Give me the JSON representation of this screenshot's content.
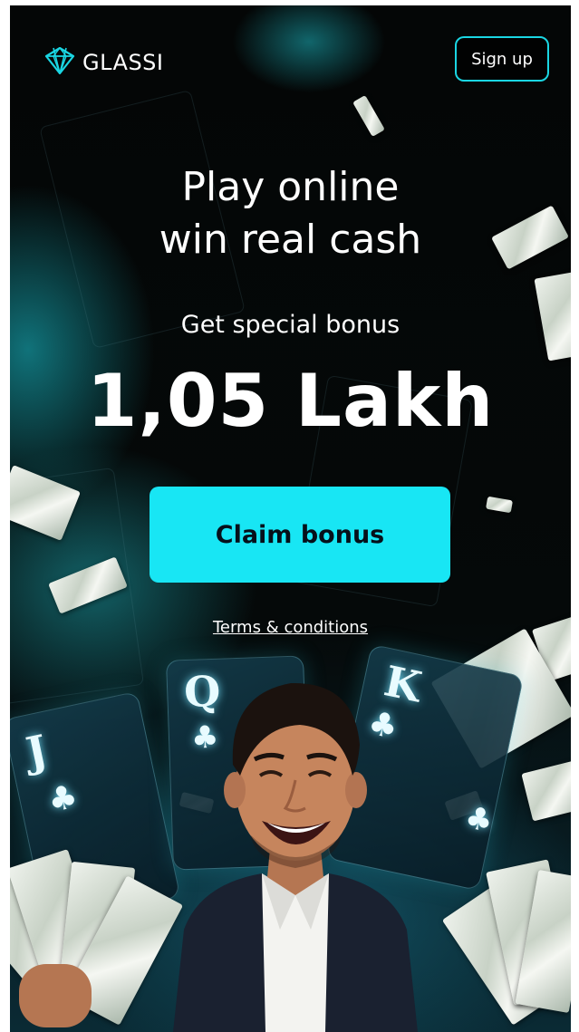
{
  "brand": {
    "name": "GLASSI",
    "accent_color": "#1ad6e3",
    "logo_icon": "diamond-icon"
  },
  "header": {
    "signup_label": "Sign up"
  },
  "hero": {
    "headline_line1": "Play online",
    "headline_line2": "win real cash",
    "subheading": "Get special bonus",
    "amount": "1,05 Lakh"
  },
  "cta": {
    "claim_label": "Claim bonus",
    "claim_color": "#18e6f4"
  },
  "links": {
    "terms_label": "Terms & conditions"
  },
  "cards": {
    "left_letter": "J",
    "center_letter": "Q",
    "right_letter": "K",
    "suit_icon": "club-icon"
  }
}
